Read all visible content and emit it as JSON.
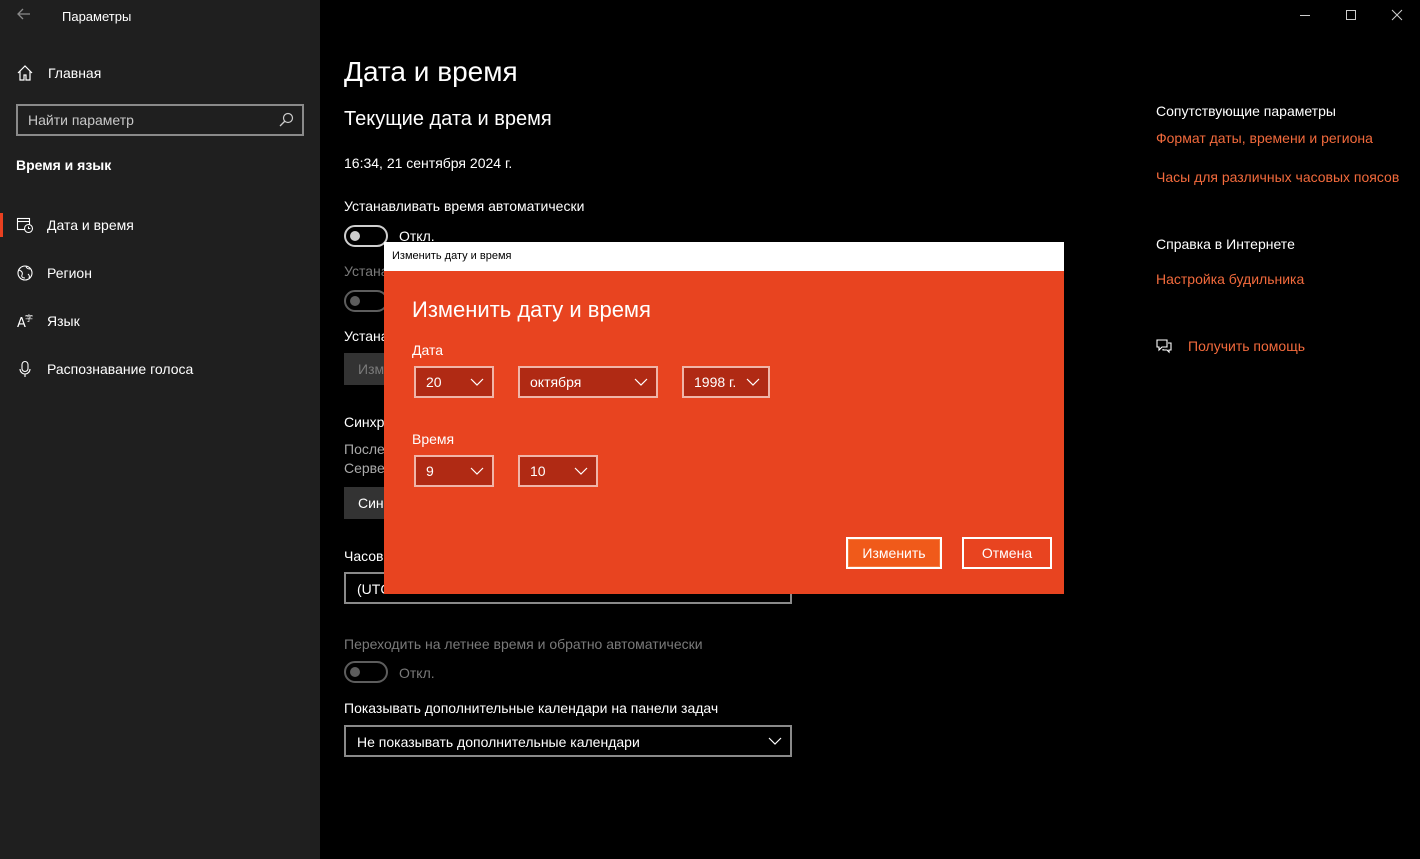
{
  "app": {
    "title": "Параметры"
  },
  "sidebar": {
    "home_label": "Главная",
    "search_placeholder": "Найти параметр",
    "section_title": "Время и язык",
    "items": [
      {
        "label": "Дата и время",
        "icon": "calendar-clock-icon"
      },
      {
        "label": "Регион",
        "icon": "globe-icon"
      },
      {
        "label": "Язык",
        "icon": "language-icon"
      },
      {
        "label": "Распознавание голоса",
        "icon": "microphone-icon"
      }
    ]
  },
  "main": {
    "title": "Дата и время",
    "subtitle": "Текущие дата и время",
    "current_datetime": "16:34, 21 сентября 2024 г.",
    "auto_time_label": "Устанавливать время автоматически",
    "auto_time_state": "Откл.",
    "auto_tz_label_partial": "Устана",
    "set_manual_label_partial": "Устана",
    "change_button_partial": "Изм",
    "sync_title_partial": "Синхр",
    "sync_line1_partial": "После",
    "sync_line2_partial": "Серве",
    "sync_button_partial": "Син",
    "timezone_label_partial": "Часов",
    "timezone_value_partial": "(UTC",
    "dst_label": "Переходить на летнее время и обратно автоматически",
    "dst_state": "Откл.",
    "calendars_label": "Показывать дополнительные календари на панели задач",
    "calendars_value": "Не показывать дополнительные календари"
  },
  "related": {
    "title": "Сопутствующие параметры",
    "link1": "Формат даты, времени и региона",
    "link2": "Часы для различных часовых поясов",
    "help_title": "Справка в Интернете",
    "help_link": "Настройка будильника",
    "get_help": "Получить помощь"
  },
  "dialog": {
    "window_title": "Изменить дату и время",
    "heading": "Изменить дату и время",
    "date_label": "Дата",
    "day": "20",
    "month": "октября",
    "year": "1998 г.",
    "time_label": "Время",
    "hour": "9",
    "minute": "10",
    "ok_label": "Изменить",
    "cancel_label": "Отмена"
  },
  "colors": {
    "accent": "#e84420",
    "link": "#f26a3c",
    "sidebar_bg": "#1f1f1f"
  }
}
